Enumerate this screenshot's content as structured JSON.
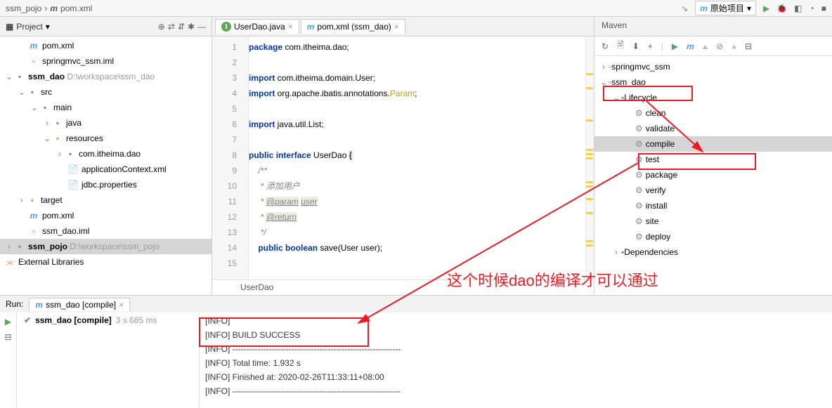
{
  "breadcrumb": {
    "p1": "ssm_pojo",
    "sep": "›",
    "p2": "pom.xml",
    "m": "m"
  },
  "topRight": {
    "origLabel": "原始项目",
    "m": "m"
  },
  "projectPanel": {
    "title": "Project",
    "tree": {
      "pom1": "pom.xml",
      "iml1": "springmvc_ssm.iml",
      "ssmDao": "ssm_dao",
      "ssmDaoPath": "D:\\workspace\\ssm_dao",
      "src": "src",
      "main": "main",
      "java": "java",
      "resources": "resources",
      "daoPkg": "com.itheima.dao",
      "appCtx": "applicationContext.xml",
      "jdbc": "jdbc.properties",
      "target": "target",
      "pom2": "pom.xml",
      "iml2": "ssm_dao.iml",
      "ssmPojo": "ssm_pojo",
      "ssmPojoPath": "D:\\workspace\\ssm_pojo",
      "extLib": "External Libraries"
    }
  },
  "editor": {
    "tab1": "UserDao.java",
    "tab2": "pom.xml (ssm_dao)",
    "lines": [
      "1",
      "2",
      "3",
      "4",
      "5",
      "6",
      "7",
      "8",
      "9",
      "10",
      "11",
      "12",
      "13",
      "14",
      "15"
    ],
    "code": {
      "l1_kw": "package",
      "l1_rest": " com.itheima.dao;",
      "l3_kw": "import",
      "l3_rest": " com.itheima.domain.User;",
      "l4_kw": "import",
      "l4_rest": " org.apache.ibatis.annotations.",
      "l4_param": "Param",
      "l4_semi": ";",
      "l6_kw": "import",
      "l6_rest": " java.util.List;",
      "l8_kw1": "public",
      "l8_kw2": "interface",
      "l8_name": " UserDao ",
      "l8_brace": "{",
      "l9": "    /**",
      "l10a": "     * ",
      "l10": "添加用户",
      "l11a": "     * ",
      "l11_tag": "@param",
      "l11_sp": " ",
      "l11_p": "user",
      "l12a": "     * ",
      "l12_tag": "@return",
      "l13": "     */",
      "l14_kw1": "    public ",
      "l14_kw2": "boolean",
      "l14_rest": " save(User user);"
    },
    "bottomCrumb": "UserDao"
  },
  "maven": {
    "title": "Maven",
    "tree": {
      "springmvc": "springmvc_ssm",
      "ssmDao": "ssm_dao",
      "lifecycle": "Lifecycle",
      "clean": "clean",
      "validate": "validate",
      "compile": "compile",
      "test": "test",
      "package": "package",
      "verify": "verify",
      "install": "install",
      "site": "site",
      "deploy": "deploy",
      "deps": "Dependencies"
    }
  },
  "annotation": "这个时候dao的编译才可以通过",
  "run": {
    "label": "Run:",
    "tabM": "m",
    "tabName": "ssm_dao [compile]",
    "item": "ssm_dao [compile]",
    "time": "3 s 685 ms",
    "out": {
      "l1": "[INFO]",
      "l2": "[INFO]  BUILD SUCCESS",
      "l3": "[INFO] ------------------------------------------------------------",
      "l4": "[INFO] Total time:  1.932 s",
      "l5": "[INFO] Finished at: 2020-02-26T11:33:11+08:00",
      "l6": "[INFO] ------------------------------------------------------------"
    }
  }
}
